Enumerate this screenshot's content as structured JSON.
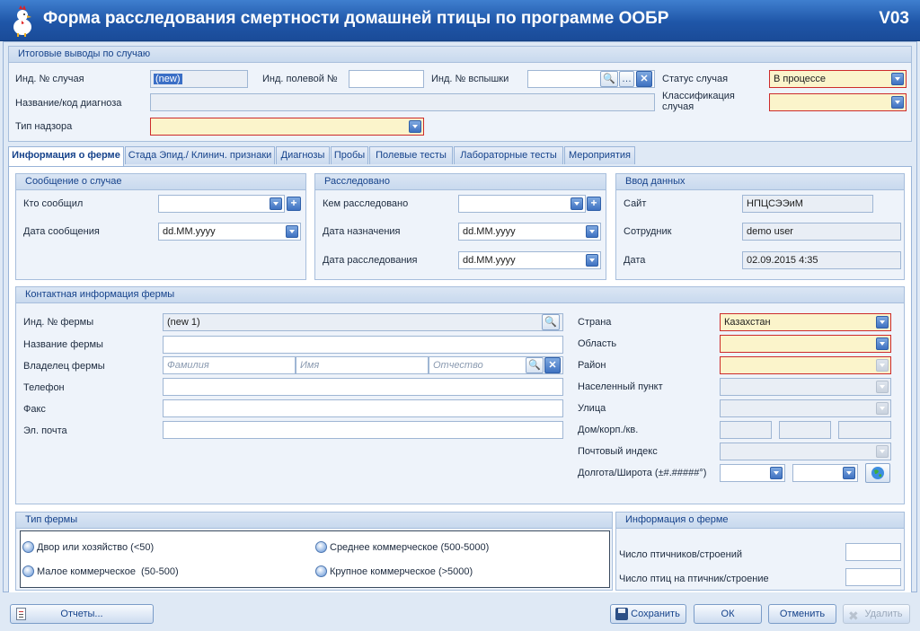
{
  "window": {
    "title": "Форма расследования смертности домашней птицы по программе ООБР",
    "version": "V03"
  },
  "summary": {
    "header": "Итоговые выводы по случаю",
    "case_id_label": "Инд. № случая",
    "case_id_value": "(new)",
    "field_id_label": "Инд. полевой №",
    "outbreak_id_label": "Инд. № вспышки",
    "case_status_label": "Статус случая",
    "case_status_value": "В процессе",
    "diagnosis_label": "Название/код диагноза",
    "classification_label": "Классификация случая",
    "surveillance_type_label": "Тип надзора"
  },
  "tabs": [
    {
      "label": "Информация о ферме"
    },
    {
      "label": "Стада Эпид./ Клинич. признаки"
    },
    {
      "label": "Диагнозы"
    },
    {
      "label": "Пробы"
    },
    {
      "label": "Полевые тесты"
    },
    {
      "label": "Лабораторные тесты"
    },
    {
      "label": "Мероприятия"
    }
  ],
  "notification": {
    "header": "Сообщение о случае",
    "reported_by_label": "Кто сообщил",
    "report_date_label": "Дата сообщения",
    "report_date_value": "dd.MM.yyyy"
  },
  "investigation": {
    "header": "Расследовано",
    "investigated_by_label": "Кем расследовано",
    "assigned_date_label": "Дата назначения",
    "assigned_date_value": "dd.MM.yyyy",
    "investigation_date_label": "Дата расследования",
    "investigation_date_value": "dd.MM.yyyy"
  },
  "data_entry": {
    "header": "Ввод данных",
    "site_label": "Сайт",
    "site_value": "НПЦСЭЭиМ",
    "employee_label": "Сотрудник",
    "employee_value": "demo user",
    "date_label": "Дата",
    "date_value": "02.09.2015 4:35"
  },
  "farm_contact": {
    "header": "Контактная информация фермы",
    "farm_id_label": "Инд. № фермы",
    "farm_id_value": "(new 1)",
    "farm_name_label": "Название фермы",
    "owner_label": "Владелец фермы",
    "last_name_placeholder": "Фамилия",
    "first_name_placeholder": "Имя",
    "middle_name_placeholder": "Отчество",
    "phone_label": "Телефон",
    "fax_label": "Факс",
    "email_label": "Эл. почта",
    "country_label": "Страна",
    "country_value": "Казахстан",
    "region_label": "Область",
    "district_label": "Район",
    "settlement_label": "Населенный пункт",
    "street_label": "Улица",
    "house_label": "Дом/корп./кв.",
    "postal_label": "Почтовый индекс",
    "coords_label": "Долгота/Широта (±#.#####°)"
  },
  "farm_type": {
    "header": "Тип фермы",
    "options": [
      {
        "label": "Двор или хозяйство (<50)"
      },
      {
        "label": "Среднее коммерческое (500-5000)"
      },
      {
        "label": "Малое коммерческое  (50-500)"
      },
      {
        "label": "Крупное коммерческое (>5000)"
      }
    ]
  },
  "farm_info": {
    "header": "Информация о ферме",
    "barns_label": "Число птичников/строений",
    "birds_label": "Число птиц на птичник/строение"
  },
  "buttons": {
    "reports": "Отчеты...",
    "save": "Сохранить",
    "ok": "ОК",
    "cancel": "Отменить",
    "delete": "Удалить"
  }
}
